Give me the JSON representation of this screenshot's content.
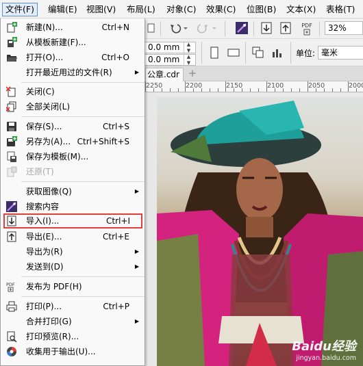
{
  "menubar": {
    "items": [
      {
        "label": "文件(F)"
      },
      {
        "label": "编辑(E)"
      },
      {
        "label": "视图(V)"
      },
      {
        "label": "布局(L)"
      },
      {
        "label": "对象(C)"
      },
      {
        "label": "效果(C)"
      },
      {
        "label": "位图(B)"
      },
      {
        "label": "文本(X)"
      },
      {
        "label": "表格(T)"
      }
    ]
  },
  "toolbar": {
    "pdf_label": "PDF",
    "zoom_value": "32%",
    "width_value": "0.0 mm",
    "height_value": "0.0 mm",
    "units_label": "单位:",
    "units_value": "毫米"
  },
  "tabs": {
    "document_tab": "公章.cdr",
    "add_tab": "+"
  },
  "ruler": {
    "ticks": [
      "2250",
      "2200",
      "2150",
      "2100",
      "2050",
      "2000"
    ]
  },
  "file_menu": {
    "items": [
      {
        "label": "新建(N)...",
        "shortcut": "Ctrl+N",
        "icon": "new-document-icon"
      },
      {
        "label": "从模板新建(F)...",
        "shortcut": "",
        "icon": "new-from-template-icon"
      },
      {
        "label": "打开(O)...",
        "shortcut": "Ctrl+O",
        "icon": "open-folder-icon"
      },
      {
        "label": "打开最近用过的文件(R)",
        "shortcut": "",
        "icon": "",
        "submenu": true
      },
      {
        "label": "关闭(C)",
        "shortcut": "",
        "icon": "close-document-icon"
      },
      {
        "label": "全部关闭(L)",
        "shortcut": "",
        "icon": "close-all-icon"
      },
      {
        "label": "保存(S)...",
        "shortcut": "Ctrl+S",
        "icon": "save-icon"
      },
      {
        "label": "另存为(A)...",
        "shortcut": "Ctrl+Shift+S",
        "icon": "save-as-icon"
      },
      {
        "label": "保存为模板(M)...",
        "shortcut": "",
        "icon": "save-as-template-icon"
      },
      {
        "label": "还原(T)",
        "shortcut": "",
        "icon": "revert-icon",
        "disabled": true
      },
      {
        "label": "获取图像(Q)",
        "shortcut": "",
        "icon": "",
        "submenu": true
      },
      {
        "label": "搜索内容",
        "shortcut": "",
        "icon": "search-content-icon"
      },
      {
        "label": "导入(I)...",
        "shortcut": "Ctrl+I",
        "icon": "import-icon",
        "highlighted": true
      },
      {
        "label": "导出(E)...",
        "shortcut": "Ctrl+E",
        "icon": "export-icon"
      },
      {
        "label": "导出为(R)",
        "shortcut": "",
        "icon": "",
        "submenu": true
      },
      {
        "label": "发送到(D)",
        "shortcut": "",
        "icon": "",
        "submenu": true
      },
      {
        "label": "发布为 PDF(H)",
        "shortcut": "",
        "icon": "publish-pdf-icon"
      },
      {
        "label": "打印(P)...",
        "shortcut": "Ctrl+P",
        "icon": "print-icon"
      },
      {
        "label": "合并打印(G)",
        "shortcut": "",
        "icon": "",
        "submenu": true
      },
      {
        "label": "打印预览(R)...",
        "shortcut": "",
        "icon": "print-preview-icon"
      },
      {
        "label": "收集用于输出(U)...",
        "shortcut": "",
        "icon": "collect-for-output-icon"
      }
    ]
  },
  "watermark": {
    "brand": "Baidu经验",
    "url": "jingyan.baidu.com"
  },
  "colors": {
    "highlight_border": "#e23c3c",
    "menu_active": "#5c8fd1"
  }
}
